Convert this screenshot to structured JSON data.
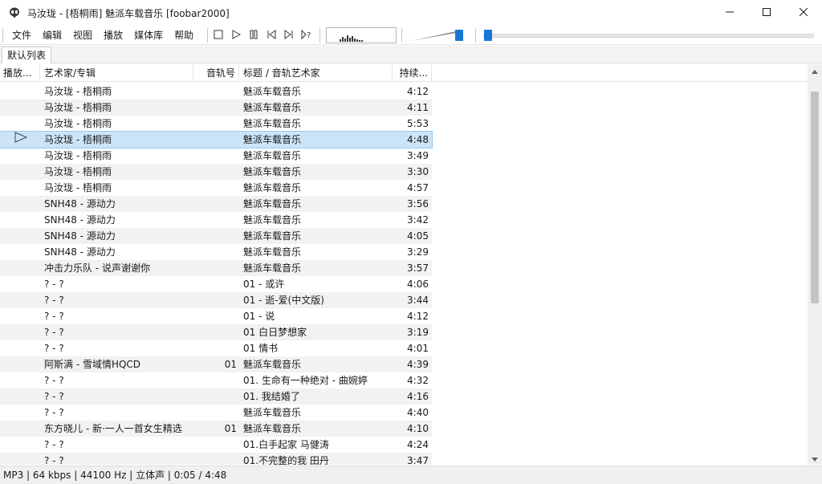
{
  "window": {
    "title": "马汝珑 - [梧桐雨] 魅派车载音乐  [foobar2000]",
    "app_icon": "alien-icon",
    "minimize_icon": "minimize-icon",
    "maximize_icon": "maximize-icon",
    "close_icon": "close-icon"
  },
  "menu": [
    "文件",
    "编辑",
    "视图",
    "播放",
    "媒体库",
    "帮助"
  ],
  "toolbar": {
    "buttons": [
      "stop-icon",
      "play-icon",
      "pause-icon",
      "previous-icon",
      "next-icon",
      "random-icon"
    ],
    "volume_level": 1.0,
    "seek_fraction": 0.017
  },
  "tabs": [
    "默认列表"
  ],
  "columns": [
    "播放...",
    "艺术家/专辑",
    "音轨号",
    "标题 / 音轨艺术家",
    "持续..."
  ],
  "rows": [
    {
      "artist": "马汝珑 - 梧桐雨",
      "track": "",
      "title": "魅派车载音乐",
      "duration": "4:12"
    },
    {
      "artist": "马汝珑 - 梧桐雨",
      "track": "",
      "title": "魅派车载音乐",
      "duration": "4:11"
    },
    {
      "artist": "马汝珑 - 梧桐雨",
      "track": "",
      "title": "魅派车载音乐",
      "duration": "5:53"
    },
    {
      "artist": "马汝珑 - 梧桐雨",
      "track": "",
      "title": "魅派车载音乐",
      "duration": "4:48",
      "playing": true
    },
    {
      "artist": "马汝珑 - 梧桐雨",
      "track": "",
      "title": "魅派车载音乐",
      "duration": "3:49"
    },
    {
      "artist": "马汝珑 - 梧桐雨",
      "track": "",
      "title": "魅派车载音乐",
      "duration": "3:30"
    },
    {
      "artist": "马汝珑 - 梧桐雨",
      "track": "",
      "title": "魅派车载音乐",
      "duration": "4:57"
    },
    {
      "artist": "SNH48 - 源动力",
      "track": "",
      "title": "魅派车载音乐",
      "duration": "3:56"
    },
    {
      "artist": "SNH48 - 源动力",
      "track": "",
      "title": "魅派车载音乐",
      "duration": "3:42"
    },
    {
      "artist": "SNH48 - 源动力",
      "track": "",
      "title": "魅派车载音乐",
      "duration": "4:05"
    },
    {
      "artist": "SNH48 - 源动力",
      "track": "",
      "title": "魅派车载音乐",
      "duration": "3:29"
    },
    {
      "artist": "冲击力乐队 - 说声谢谢你",
      "track": "",
      "title": "魅派车载音乐",
      "duration": "3:57"
    },
    {
      "artist": "? - ?",
      "track": "",
      "title": "01 - 或许",
      "duration": "4:06"
    },
    {
      "artist": "? - ?",
      "track": "",
      "title": "01 - 逝-爱(中文版)",
      "duration": "3:44"
    },
    {
      "artist": "? - ?",
      "track": "",
      "title": "01 - 说",
      "duration": "4:12"
    },
    {
      "artist": "? - ?",
      "track": "",
      "title": "01 白日梦想家",
      "duration": "3:19"
    },
    {
      "artist": "? - ?",
      "track": "",
      "title": "01 情书",
      "duration": "4:01"
    },
    {
      "artist": "阿斯满 - 雪域情HQCD",
      "track": "01",
      "title": "魅派车载音乐",
      "duration": "4:39"
    },
    {
      "artist": "? - ?",
      "track": "",
      "title": "01. 生命有一种绝对 - 曲婉婷",
      "duration": "4:32"
    },
    {
      "artist": "? - ?",
      "track": "",
      "title": "01. 我结婚了",
      "duration": "4:16"
    },
    {
      "artist": "? - ?",
      "track": "",
      "title": "魅派车载音乐",
      "duration": "4:40"
    },
    {
      "artist": "东方晓儿 - 新·一人一首女生精选",
      "track": "01",
      "title": "魅派车载音乐",
      "duration": "4:10"
    },
    {
      "artist": "? - ?",
      "track": "",
      "title": "01.白手起家 马健涛",
      "duration": "4:24"
    },
    {
      "artist": "? - ?",
      "track": "",
      "title": "01.不完整的我 田丹",
      "duration": "3:47"
    }
  ],
  "status": "MP3 | 64 kbps | 44100 Hz | 立体声 | 0:05 / 4:48",
  "colors": {
    "accent": "#1777d8",
    "selection": "#cce4f7",
    "alt_row": "#f2f2f2"
  }
}
